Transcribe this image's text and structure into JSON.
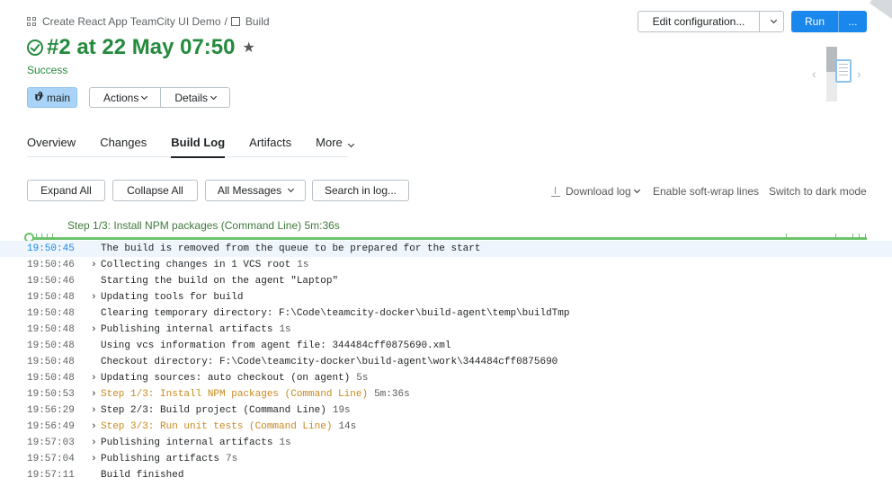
{
  "breadcrumb": {
    "project": "Create React App TeamCity UI Demo",
    "separator": "/",
    "build_config": "Build"
  },
  "header": {
    "title": "#2 at 22 May 07:50",
    "status": "Success",
    "status_color": "#248a3d",
    "branch": "main",
    "actions_label": "Actions",
    "details_label": "Details",
    "edit_config_label": "Edit configuration...",
    "run_label": "Run",
    "run_more_label": "..."
  },
  "tabs": [
    {
      "label": "Overview",
      "active": false
    },
    {
      "label": "Changes",
      "active": false
    },
    {
      "label": "Build Log",
      "active": true
    },
    {
      "label": "Artifacts",
      "active": false
    },
    {
      "label": "More",
      "active": false
    }
  ],
  "toolbar": {
    "expand_all": "Expand All",
    "collapse_all": "Collapse All",
    "all_messages": "All Messages",
    "search": "Search in log...",
    "download_log": "Download log",
    "soft_wrap": "Enable soft-wrap lines",
    "dark_mode": "Switch to dark mode"
  },
  "timeline": {
    "step_label": "Step 1/3: Install NPM packages (Command Line) 5m:36s",
    "color": "#6cc36c"
  },
  "log": [
    {
      "time": "19:50:45",
      "expandable": false,
      "message": "The build is removed from the queue to be prepared for the start",
      "duration": "",
      "step": false,
      "highlight": true
    },
    {
      "time": "19:50:46",
      "expandable": true,
      "message": "Collecting changes in 1 VCS root",
      "duration": "1s",
      "step": false,
      "highlight": false
    },
    {
      "time": "19:50:46",
      "expandable": false,
      "message": "Starting the build on the agent \"Laptop\"",
      "duration": "",
      "step": false,
      "highlight": false
    },
    {
      "time": "19:50:48",
      "expandable": true,
      "message": "Updating tools for build",
      "duration": "",
      "step": false,
      "highlight": false
    },
    {
      "time": "19:50:48",
      "expandable": false,
      "message": "Clearing temporary directory: F:\\Code\\teamcity-docker\\build-agent\\temp\\buildTmp",
      "duration": "",
      "step": false,
      "highlight": false
    },
    {
      "time": "19:50:48",
      "expandable": true,
      "message": "Publishing internal artifacts",
      "duration": "1s",
      "step": false,
      "highlight": false
    },
    {
      "time": "19:50:48",
      "expandable": false,
      "message": "Using vcs information from agent file: 344484cff0875690.xml",
      "duration": "",
      "step": false,
      "highlight": false
    },
    {
      "time": "19:50:48",
      "expandable": false,
      "message": "Checkout directory: F:\\Code\\teamcity-docker\\build-agent\\work\\344484cff0875690",
      "duration": "",
      "step": false,
      "highlight": false
    },
    {
      "time": "19:50:48",
      "expandable": true,
      "message": "Updating sources: auto checkout (on agent)",
      "duration": "5s",
      "step": false,
      "highlight": false
    },
    {
      "time": "19:50:53",
      "expandable": true,
      "message": "Step 1/3: Install NPM packages (Command Line)",
      "duration": "5m:36s",
      "step": true,
      "highlight": false
    },
    {
      "time": "19:56:29",
      "expandable": true,
      "message": "Step 2/3: Build project (Command Line)",
      "duration": "19s",
      "step": false,
      "highlight": false
    },
    {
      "time": "19:56:49",
      "expandable": true,
      "message": "Step 3/3: Run unit tests (Command Line)",
      "duration": "14s",
      "step": true,
      "highlight": false
    },
    {
      "time": "19:57:03",
      "expandable": true,
      "message": "Publishing internal artifacts",
      "duration": "1s",
      "step": false,
      "highlight": false
    },
    {
      "time": "19:57:04",
      "expandable": true,
      "message": "Publishing artifacts",
      "duration": "7s",
      "step": false,
      "highlight": false
    },
    {
      "time": "19:57:11",
      "expandable": false,
      "message": "Build finished",
      "duration": "",
      "step": false,
      "highlight": false
    }
  ]
}
